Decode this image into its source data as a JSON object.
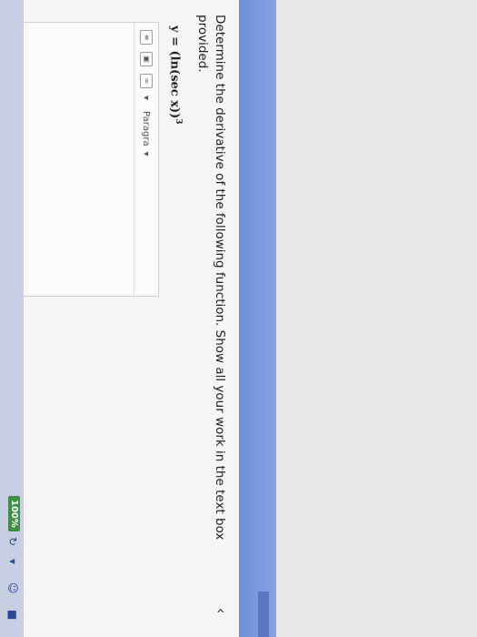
{
  "question": {
    "prompt": "Determine the derivative of the following function. Show all your work in the text box provided.",
    "function_text": "y = (ln(sec x))",
    "function_exponent": "3"
  },
  "editor": {
    "paragraph_select": "Paragra",
    "more_label": "•••"
  },
  "status_bar": {
    "zoom": "100%"
  },
  "colors": {
    "taskbar_blue": "#7b98de",
    "zoom_green": "#3d8f43"
  }
}
